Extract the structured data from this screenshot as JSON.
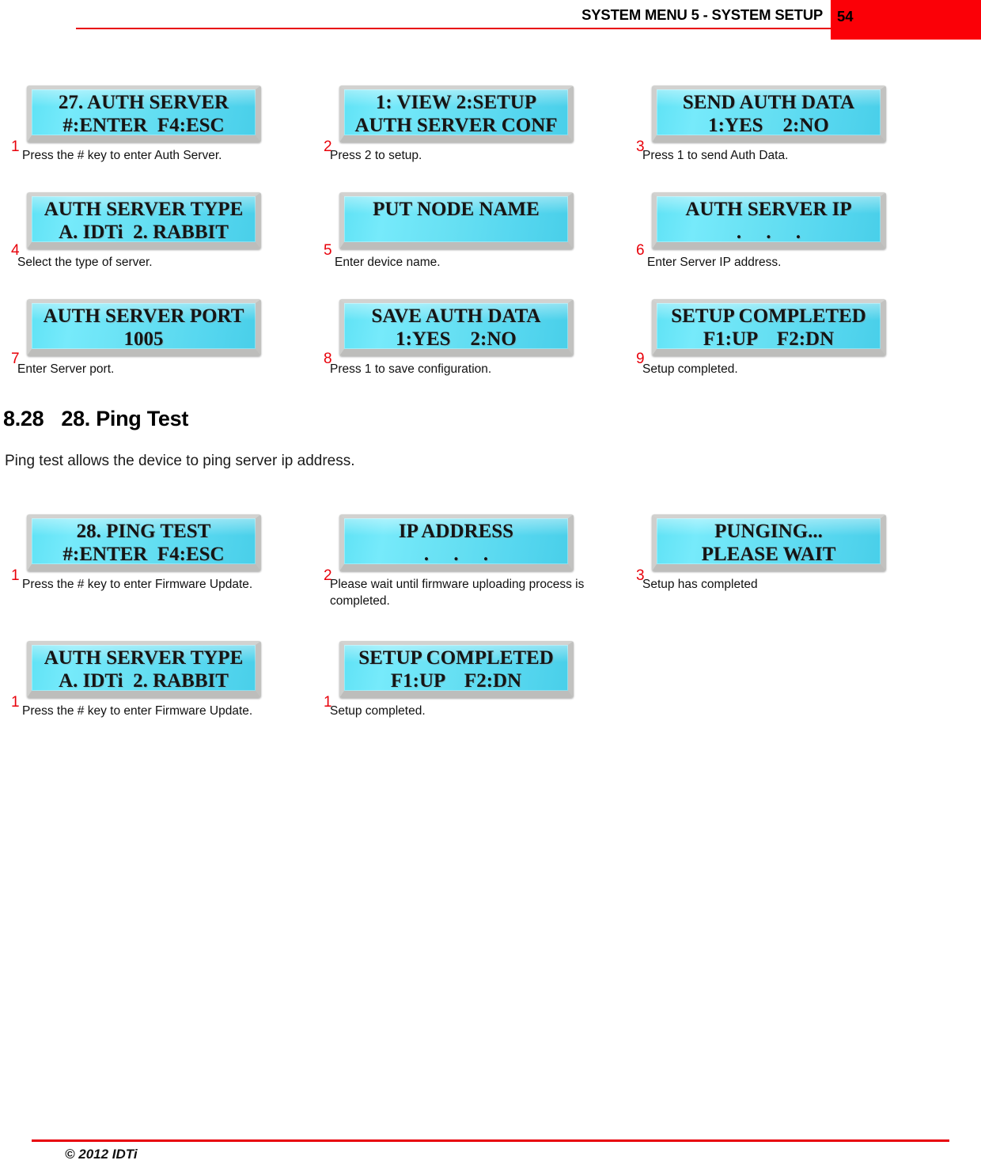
{
  "header": {
    "title": "SYSTEM MENU 5 - SYSTEM SETUP",
    "page_number": "54",
    "accent_color": "#fb0007"
  },
  "section": {
    "number": "8.28",
    "title": "28. Ping Test",
    "intro": "Ping test allows the device to ping server ip address."
  },
  "footer": {
    "copyright": "© 2012 IDTi"
  },
  "auth_server_steps": [
    {
      "number": "1",
      "line1": "27. AUTH SERVER",
      "line2": "#:ENTER  F4:ESC",
      "caption": "Press the # key to enter Auth Server."
    },
    {
      "number": "2",
      "line1": "1: VIEW 2:SETUP",
      "line2": "AUTH SERVER CONF",
      "caption": "Press 2 to setup."
    },
    {
      "number": "3",
      "line1": "SEND AUTH DATA",
      "line2": "1:YES    2:NO",
      "caption": "Press 1 to send Auth Data."
    },
    {
      "number": "4",
      "line1": "AUTH SERVER TYPE",
      "line2": "A. IDTi  2. RABBIT",
      "caption": "Select the type of server."
    },
    {
      "number": "5",
      "line1": "PUT NODE NAME",
      "line2": "",
      "caption": "Enter device name."
    },
    {
      "number": "6",
      "line1": "AUTH SERVER IP",
      "line2": ".     .     .",
      "caption": "Enter Server IP address."
    },
    {
      "number": "7",
      "line1": "AUTH SERVER PORT",
      "line2": "1005",
      "caption": "Enter Server port."
    },
    {
      "number": "8",
      "line1": "SAVE AUTH DATA",
      "line2": "1:YES    2:NO",
      "caption": "Press 1 to save configuration."
    },
    {
      "number": "9",
      "line1": "SETUP COMPLETED",
      "line2": "F1:UP    F2:DN",
      "caption": "Setup completed."
    }
  ],
  "ping_test_steps": [
    {
      "number": "1",
      "line1": "28. PING TEST",
      "line2": "#:ENTER  F4:ESC",
      "caption": "Press the # key to enter Firmware Update."
    },
    {
      "number": "2",
      "line1": "IP ADDRESS",
      "line2": ".     .     .",
      "caption": "Please wait until firmware uploading process is completed."
    },
    {
      "number": "3",
      "line1": "PUNGING...",
      "line2": "PLEASE WAIT",
      "caption": "Setup has completed"
    },
    {
      "number": "1",
      "line1": "AUTH SERVER TYPE",
      "line2": "A. IDTi  2. RABBIT",
      "caption": "Press the # key to enter Firmware Update."
    },
    {
      "number": "1",
      "line1": "SETUP COMPLETED",
      "line2": "F1:UP    F2:DN",
      "caption": "Setup completed."
    }
  ]
}
